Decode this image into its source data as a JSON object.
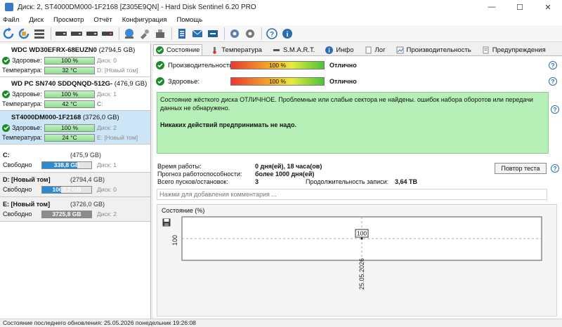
{
  "window": {
    "title": "Диск: 2, ST4000DM000-1F2168 [Z305E9QN]  -  Hard Disk Sentinel 6.20 PRO",
    "minimize": "—",
    "maximize": "☐",
    "close": "✕"
  },
  "menu": [
    "Файл",
    "Диск",
    "Просмотр",
    "Отчёт",
    "Конфигурация",
    "Помощь"
  ],
  "disks": [
    {
      "name": "WDC WD30EFRX-68EUZN0",
      "capacity": "(2794,5 GB)",
      "health_label": "Здоровье:",
      "health": "100 %",
      "health_value": 100,
      "disk_index": "Диск: 0",
      "temp_label": "Температура:",
      "temp": "32 °C",
      "volumes": "D: [Новый том]"
    },
    {
      "name": "WD PC SN740 SDDQNQD-512G-",
      "capacity": "(476,9 GB)",
      "health_label": "Здоровье:",
      "health": "100 %",
      "health_value": 100,
      "disk_index": "Диск: 1",
      "temp_label": "Температура:",
      "temp": "42 °C",
      "volumes": "C:"
    },
    {
      "name": "ST4000DM000-1F2168",
      "capacity": "(3726,0 GB)",
      "health_label": "Здоровье:",
      "health": "100 %",
      "health_value": 100,
      "disk_index": "Диск: 2",
      "temp_label": "Температура:",
      "temp": "24 °C",
      "volumes": "E: [Новый том]"
    }
  ],
  "volumes": [
    {
      "name": "C:",
      "capacity": "(475,9 GB)",
      "free_label": "Свободно",
      "free": "338,8 GB",
      "free_fraction": 0.71,
      "disk": "Диск: 1"
    },
    {
      "name": "D: [Новый том]",
      "capacity": "(2794,4 GB)",
      "free_label": "Свободно",
      "free": "1063,2 GB",
      "free_fraction": 0.38,
      "disk": "Диск: 0"
    },
    {
      "name": "E: [Новый том]",
      "capacity": "(3726,0 GB)",
      "free_label": "Свободно",
      "free": "3725,8 GB",
      "free_fraction": 1.0,
      "disk": "Диск: 2"
    }
  ],
  "tabs": [
    "Состояние",
    "Температура",
    "S.M.A.R.T.",
    "Инфо",
    "Лог",
    "Производительность",
    "Предупреждения"
  ],
  "metrics": {
    "performance_label": "Производительность:",
    "performance": "100 %",
    "performance_value": 100,
    "performance_result": "Отлично",
    "health_label": "Здоровье:",
    "health": "100 %",
    "health_value": 100,
    "health_result": "Отлично",
    "help": "?"
  },
  "status_text": "Состояние жёсткого диска ОТЛИЧНОЕ. Проблемные или слабые сектора не найдены. ошибок набора оборотов или передачи данных не обнаружено.",
  "advice_text": "Никаких действий предпринимать не надо.",
  "info": {
    "uptime_label": "Время работы:",
    "uptime": "0 дня(ей), 18 часа(ов)",
    "lifetime_label": "Прогноз работоспособности:",
    "lifetime": "более 1000 дня(ей)",
    "starts_label": "Всего пусков/остановок:",
    "starts": "3",
    "writes_label": "Продолжительность записи:",
    "writes": "3,64 TB",
    "retest_button": "Повтор теста"
  },
  "comment_placeholder": "Нажми для добавления комментария ...",
  "chart_title": "Состояние (%)",
  "chart_data": {
    "type": "line",
    "title": "Состояние (%)",
    "x": [
      "25.05.2026"
    ],
    "series": [
      {
        "values": [
          100
        ]
      }
    ],
    "ytick_label": "100",
    "data_label": "100",
    "grid": true
  },
  "statusbar": "Состояние последнего обновления: 25.05.2026 понедельник 19:26:08"
}
